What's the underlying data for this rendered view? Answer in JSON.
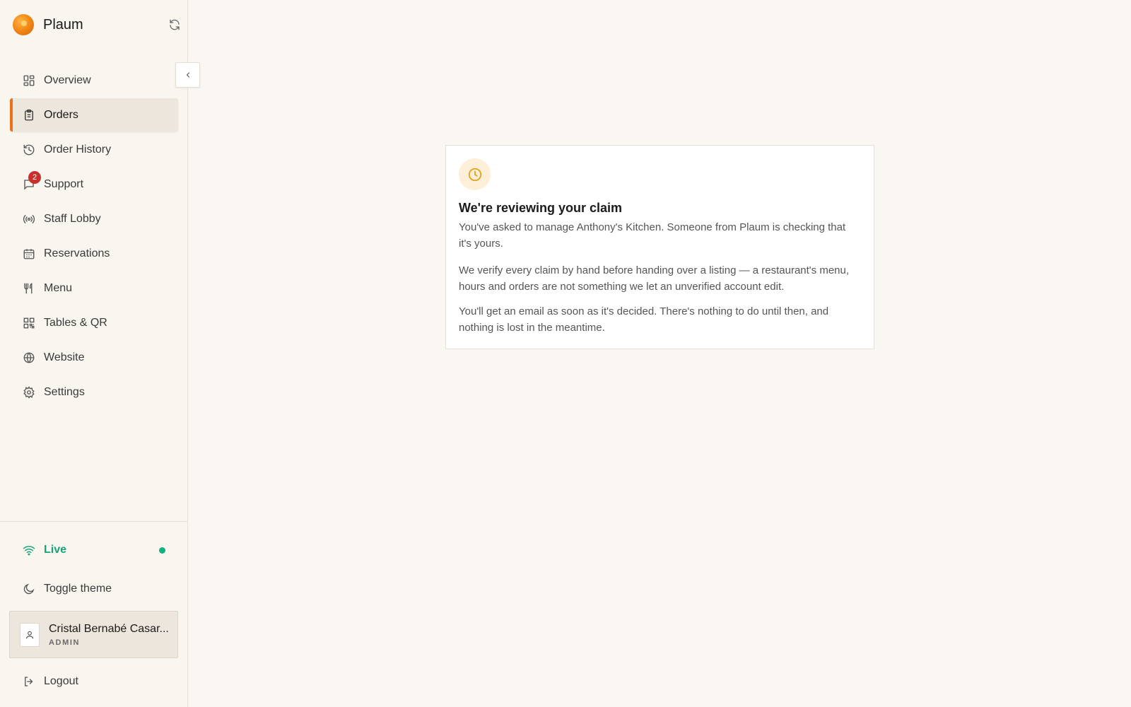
{
  "brand": {
    "name": "Plaum",
    "logo_icon": "orange-fruit-icon"
  },
  "sidebar": {
    "items": [
      {
        "label": "Overview",
        "icon": "grid-icon",
        "active": false
      },
      {
        "label": "Orders",
        "icon": "clipboard-icon",
        "active": true
      },
      {
        "label": "Order History",
        "icon": "history-icon",
        "active": false
      },
      {
        "label": "Support",
        "icon": "chat-icon",
        "active": false,
        "badge": "2"
      },
      {
        "label": "Staff Lobby",
        "icon": "broadcast-icon",
        "active": false
      },
      {
        "label": "Reservations",
        "icon": "calendar-icon",
        "active": false
      },
      {
        "label": "Menu",
        "icon": "utensils-icon",
        "active": false
      },
      {
        "label": "Tables & QR",
        "icon": "qr-code-icon",
        "active": false
      },
      {
        "label": "Website",
        "icon": "globe-icon",
        "active": false
      },
      {
        "label": "Settings",
        "icon": "gear-icon",
        "active": false
      }
    ]
  },
  "status": {
    "label": "Live",
    "color": "#16a37a"
  },
  "theme": {
    "label": "Toggle theme"
  },
  "user": {
    "name": "Cristal Bernabé Casar...",
    "role": "ADMIN"
  },
  "logout": {
    "label": "Logout"
  },
  "card": {
    "title": "We're reviewing your claim",
    "p1": "You've asked to manage Anthony's Kitchen. Someone from Plaum is checking that it's yours.",
    "p2": "We verify every claim by hand before handing over a listing — a restaurant's menu, hours and orders are not something we let an unverified account edit.",
    "p3": "You'll get an email as soon as it's decided. There's nothing to do until then, and nothing is lost in the meantime."
  },
  "colors": {
    "accent": "#e8731a",
    "badge": "#c9302c",
    "live": "#12b07f"
  }
}
